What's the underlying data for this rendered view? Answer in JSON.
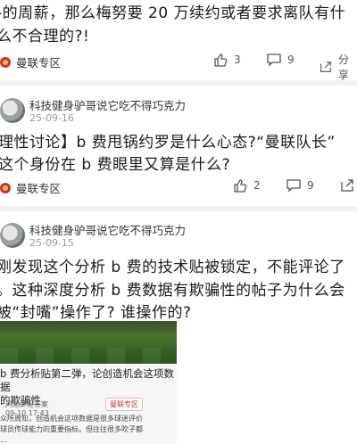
{
  "posts": [
    {
      "lines": [
        "-的周薪，那么梅努要 20 万续约或者要求离队有什",
        "么不合理的?!"
      ],
      "tag": "曼联专区",
      "likes": "3",
      "comments": "9",
      "share": "分享"
    },
    {
      "user": "科技健身驴哥说它吃不得巧克力",
      "date": "25-09-16",
      "lines": [
        "理性讨论】b 费甩锅约罗是什么心态?“曼联队长”",
        "这个身份在 b 费眼里又算是什么?"
      ],
      "tag": "曼联专区",
      "likes": "2",
      "comments": "9"
    },
    {
      "user": "科技健身驴哥说它吃不得巧克力",
      "date": "25-09-15",
      "lines": [
        "刚发现这个分析 b 费的技术贴被锁定，不能评论了",
        "。这种深度分析 b 费数据有欺骗性的帖子为什么会",
        "被“封嘴”操作了? 谁操作的?"
      ],
      "embed": {
        "title_lines": [
          "b 费分析贴第二弹，论创造机会这项数据",
          "的欺骗性"
        ],
        "author": "问题即是答案",
        "author_date": "09-10 17:43",
        "tag": "曼联专区",
        "body_lines": [
          "众所周知，创造机会这项数据是很多球迷评价",
          "球员传球能力的重要指标。但往往很多吹子都",
          "..."
        ]
      }
    }
  ],
  "colors": {
    "accent": "#d32f2f"
  }
}
